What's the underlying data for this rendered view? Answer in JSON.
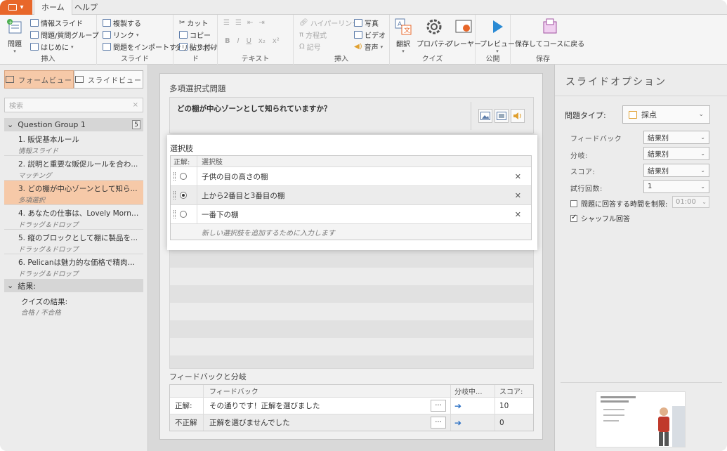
{
  "tabs": {
    "home": "ホーム",
    "help": "ヘルプ"
  },
  "ribbon": {
    "insert": {
      "question": "問題",
      "info_slide": "情報スライド",
      "question_group": "問題/質問グループ",
      "intro": "はじめに",
      "label": "挿入"
    },
    "slide": {
      "duplicate": "複製する",
      "link": "リンク",
      "import_questions": "問題をインポートする",
      "label": "スライド"
    },
    "clipboard": {
      "cut": "カット",
      "copy": "コピー",
      "paste": "貼り付け",
      "label": "クリップボード"
    },
    "text": {
      "label": "テキスト",
      "bold": "B",
      "italic": "I",
      "underline": "U",
      "subscript": "x₂",
      "superscript": "x²"
    },
    "insert2": {
      "hyperlink": "ハイパーリンク",
      "equation": "方程式",
      "symbol": "記号",
      "photo": "写真",
      "video": "ビデオ",
      "audio": "音声",
      "label": "挿入"
    },
    "quiz": {
      "translate": "翻訳",
      "properties": "プロパティ",
      "player": "プレーヤー",
      "label": "クイズ"
    },
    "publish": {
      "preview": "プレビュー",
      "label": "公開"
    },
    "save": {
      "save_return": "保存してコースに戻る",
      "label": "保存"
    }
  },
  "left": {
    "form_view": "フォームビュー",
    "slide_view": "スライドビュー",
    "search_placeholder": "検索",
    "group_name": "Question Group 1",
    "group_count": "5",
    "items": [
      {
        "title": "1. 販促基本ルール",
        "type": "情報スライド"
      },
      {
        "title": "2. 説明と重要な販促ルールを合わ...",
        "type": "マッチング"
      },
      {
        "title": "3. どの棚が中心ゾーンとして知ら...",
        "type": "多項選択"
      },
      {
        "title": "4. あなたの仕事は、Lovely Morni...",
        "type": "ドラッグ＆ドロップ"
      },
      {
        "title": "5. 縦のブロックとして棚に製品を...",
        "type": "ドラッグ＆ドロップ"
      },
      {
        "title": "6. Pelicanは魅力的な価格で精肉を...",
        "type": "ドラッグ＆ドロップ"
      }
    ],
    "results_header": "結果:",
    "results_item": {
      "title": "クイズの結果:",
      "type": "合格 / 不合格"
    }
  },
  "center": {
    "title": "多項選択式問題",
    "question": "どの棚が中心ゾーンとして知られていますか？",
    "choices_title": "選択肢",
    "col_correct": "正解:",
    "col_choice": "選択肢",
    "choices": [
      {
        "text": "子供の目の高さの棚",
        "correct": false
      },
      {
        "text": "上から2番目と3番目の棚",
        "correct": true
      },
      {
        "text": "一番下の棚",
        "correct": false
      }
    ],
    "add_placeholder": "新しい選択肢を追加するために入力します",
    "feedback_title": "フィードバックと分岐",
    "fb_col_feedback": "フィードバック",
    "fb_col_branch": "分岐中...",
    "fb_col_score": "スコア:",
    "feedback_rows": [
      {
        "label": "正解:",
        "text": "その通りです！正解を選びました",
        "score": "10"
      },
      {
        "label": "不正解",
        "text": "正解を選びませんでした",
        "score": "0"
      }
    ]
  },
  "right": {
    "title": "スライドオプション",
    "question_type_label": "問題タイプ:",
    "question_type": "採点",
    "options": [
      {
        "label": "フィードバック",
        "value": "結果別"
      },
      {
        "label": "分岐:",
        "value": "結果別"
      },
      {
        "label": "スコア:",
        "value": "結果別"
      },
      {
        "label": "試行回数:",
        "value": "1"
      }
    ],
    "time_limit_label": "問題に回答する時間を制限:",
    "time_limit_value": "01:00",
    "shuffle_label": "シャッフル回答"
  },
  "colors": {
    "accent": "#e8672a",
    "selection": "#f6c9a8",
    "link_arrow": "#2a6fc4"
  }
}
